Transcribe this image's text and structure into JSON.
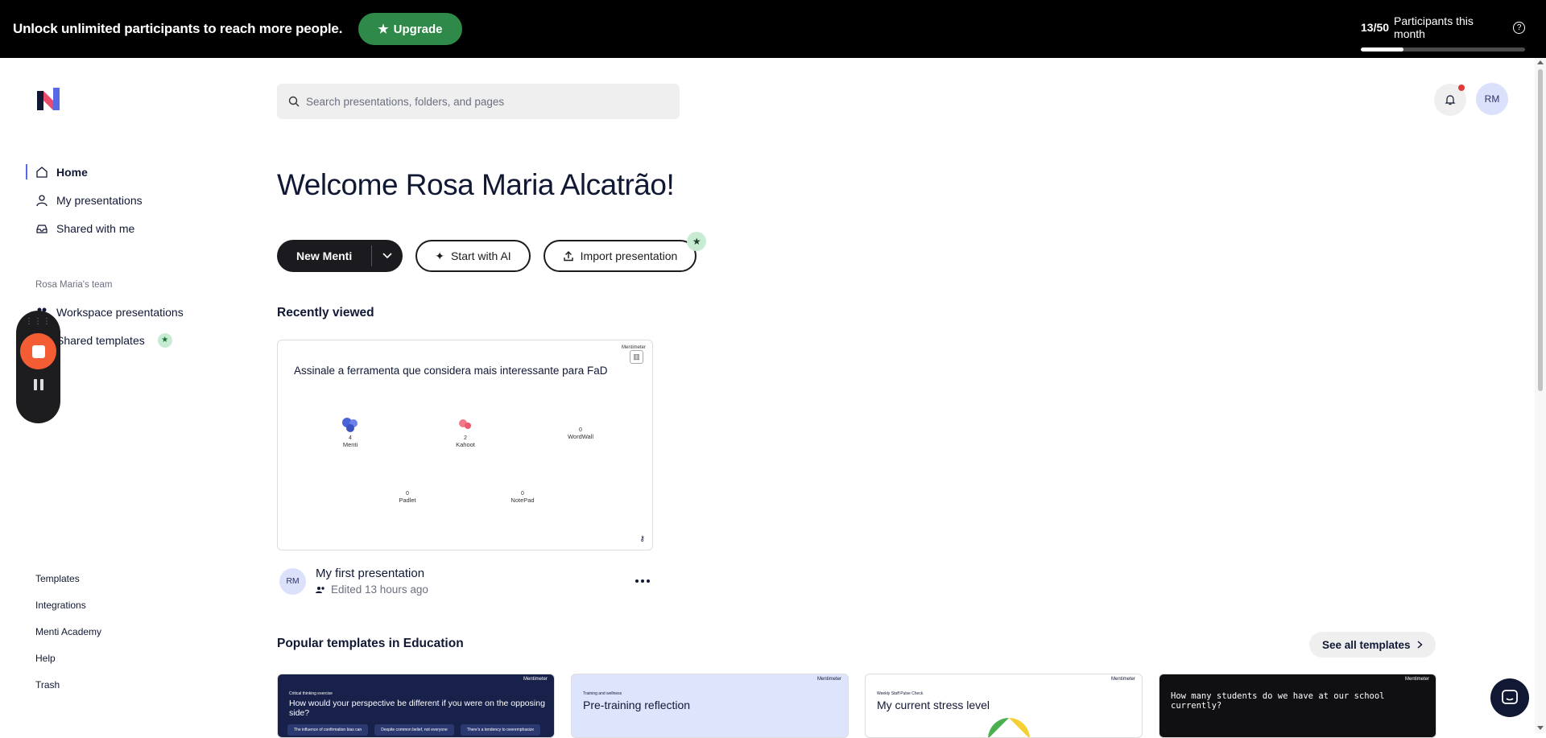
{
  "banner": {
    "message": "Unlock unlimited participants to reach more people.",
    "upgrade_label": "Upgrade",
    "participants_count": "13/50",
    "participants_label": "Participants this month",
    "participants_progress": 0.26
  },
  "search": {
    "placeholder": "Search presentations, folders, and pages"
  },
  "user": {
    "initials": "RM"
  },
  "sidebar": {
    "nav": [
      {
        "label": "Home",
        "icon": "home-icon"
      },
      {
        "label": "My presentations",
        "icon": "person-icon"
      },
      {
        "label": "Shared with me",
        "icon": "inbox-icon"
      }
    ],
    "team_label": "Rosa Maria's team",
    "team_nav": [
      {
        "label": "Workspace presentations",
        "icon": "people-icon"
      },
      {
        "label": "Shared templates",
        "icon": "template-icon"
      }
    ],
    "footer": [
      "Templates",
      "Integrations",
      "Menti Academy",
      "Help",
      "Trash"
    ]
  },
  "main": {
    "welcome": "Welcome Rosa Maria Alcatrão!",
    "new_menti_label": "New Menti",
    "start_ai_label": "Start with AI",
    "import_label": "Import presentation",
    "recent_title": "Recently viewed",
    "recent_card": {
      "brand": "Mentimeter",
      "question": "Assinale a ferramenta que considera mais interessante para FaD",
      "options": [
        {
          "label": "Menti",
          "count": "4"
        },
        {
          "label": "Kahoot",
          "count": "2"
        },
        {
          "label": "WordWall",
          "count": "0"
        },
        {
          "label": "Padlet",
          "count": "0"
        },
        {
          "label": "NotePad",
          "count": "0"
        }
      ],
      "title": "My first presentation",
      "subtitle": "Edited 13 hours ago"
    },
    "templates_title": "Popular templates in Education",
    "see_all_label": "See all templates",
    "templates": [
      {
        "kicker": "Critical thinking exercise",
        "title": "How would your perspective be different if you were on the opposing side?",
        "chips": [
          "The influence of confirmation bias can",
          "Despite common belief, not everyone",
          "There's a tendency to overemphasize"
        ]
      },
      {
        "kicker": "Training and wellness",
        "title": "Pre-training reflection"
      },
      {
        "kicker": "Weekly Staff Pulse Check",
        "title": "My current stress level"
      },
      {
        "kicker": "",
        "title": "How many students do we have at our school currently?"
      }
    ]
  },
  "colors": {
    "banner_bg": "#000000",
    "upgrade_green": "#2f8a4a",
    "accent": "#5769e7",
    "recorder_stop": "#f45d33",
    "notification_dot": "#e03a3a"
  }
}
